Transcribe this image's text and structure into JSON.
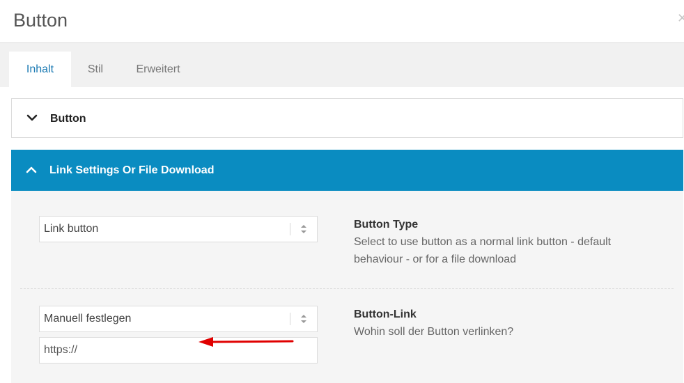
{
  "dialog": {
    "title": "Button"
  },
  "tabs": [
    {
      "label": "Inhalt",
      "active": true
    },
    {
      "label": "Stil",
      "active": false
    },
    {
      "label": "Erweitert",
      "active": false
    }
  ],
  "sections": {
    "button": {
      "label": "Button",
      "state": "collapsed"
    },
    "link": {
      "label": "Link Settings Or File Download",
      "state": "expanded"
    }
  },
  "fields": {
    "button_type": {
      "selected": "Link button",
      "title": "Button Type",
      "description": "Select to use button as a normal link button - default behaviour - or for a file download"
    },
    "button_link": {
      "selected": "Manuell festlegen",
      "url_value": "https://",
      "title": "Button-Link",
      "description": "Wohin soll der Button verlinken?"
    }
  },
  "colors": {
    "accent": "#0a8cc1",
    "active_tab_text": "#1b7ab3",
    "annotation_arrow": "#e00000"
  },
  "icons": [
    "close-icon",
    "chevron-down-icon",
    "chevron-up-icon",
    "select-arrows-icon",
    "annotation-arrow"
  ]
}
